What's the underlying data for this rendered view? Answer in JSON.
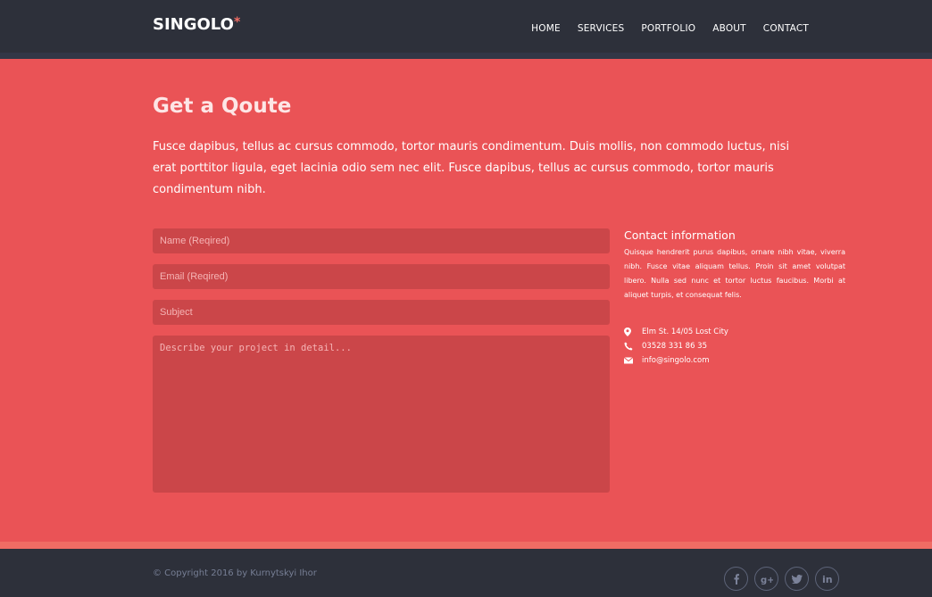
{
  "header": {
    "logo": "SINGOLO",
    "logo_star": "*",
    "nav": [
      "HOME",
      "SERVICES",
      "PORTFOLIO",
      "ABOUT",
      "CONTACT"
    ]
  },
  "quote": {
    "title": "Get a Qoute",
    "intro": "Fusce dapibus, tellus ac cursus commodo, tortor mauris condimentum. Duis mollis, non commodo luctus, nisi erat porttitor ligula, eget lacinia odio sem nec elit. Fusce dapibus, tellus ac cursus commodo, tortor mauris condimentum nibh."
  },
  "form": {
    "name_placeholder": "Name (Reqired)",
    "email_placeholder": "Email (Reqired)",
    "subject_placeholder": "Subject",
    "description_placeholder": "Describe your project in detail..."
  },
  "contact": {
    "heading": "Contact information",
    "text": "Quisque hendrerit purus dapibus, ornare nibh vitae, viverra nibh. Fusce vitae aliquam tellus. Proin sit amet volutpat libero. Nulla sed nunc et tortor luctus faucibus. Morbi at aliquet turpis, et consequat felis.",
    "address": "Elm St. 14/05 Lost City",
    "phone": "03528 331 86 35",
    "email": "info@singolo.com",
    "icons": [
      "map-pin-icon",
      "phone-icon",
      "mail-icon"
    ]
  },
  "footer": {
    "copyright": "© Copyright 2016 by Kurnytskyi Ihor",
    "socials": [
      "facebook-icon",
      "google-plus-icon",
      "twitter-icon",
      "linkedin-icon"
    ]
  },
  "colors": {
    "header_bg": "#2d303a",
    "main_bg": "#ea5356",
    "field_bg": "#cb4649",
    "accent": "#f06c64"
  }
}
